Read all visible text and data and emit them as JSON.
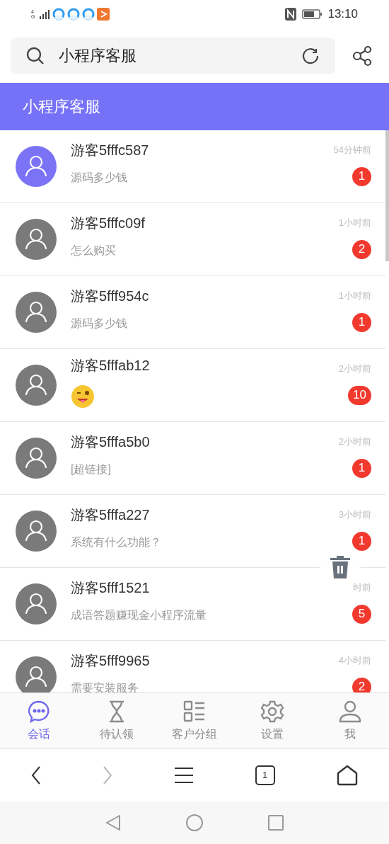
{
  "status_bar": {
    "network": "4G",
    "time": "13:10"
  },
  "search": {
    "value": "小程序客服"
  },
  "header": {
    "title": "小程序客服"
  },
  "conversations": [
    {
      "name": "游客5fffc587",
      "message": "源码多少钱",
      "kind": "text",
      "time": "54分钟前",
      "unread": "1",
      "color": "#7b73f5"
    },
    {
      "name": "游客5fffc09f",
      "message": "怎么购买",
      "kind": "text",
      "time": "1小时前",
      "unread": "2",
      "color": "#7a7a7a"
    },
    {
      "name": "游客5fff954c",
      "message": "源码多少钱",
      "kind": "text",
      "time": "1小时前",
      "unread": "1",
      "color": "#7a7a7a"
    },
    {
      "name": "游客5fffab12",
      "kind": "emoji",
      "time": "2小时前",
      "unread": "10",
      "color": "#7a7a7a"
    },
    {
      "name": "游客5fffa5b0",
      "message": "[超链接]",
      "kind": "text",
      "time": "2小时前",
      "unread": "1",
      "color": "#7a7a7a"
    },
    {
      "name": "游客5fffa227",
      "message": "系统有什么功能？",
      "kind": "text",
      "time": "3小时前",
      "unread": "1",
      "color": "#7a7a7a"
    },
    {
      "name": "游客5fff1521",
      "message": "成语答题赚现金小程序流量",
      "kind": "text",
      "time": "时前",
      "unread": "5",
      "color": "#7a7a7a"
    },
    {
      "name": "游客5fff9965",
      "message": "需要安装服务",
      "kind": "text",
      "time": "4小时前",
      "unread": "2",
      "color": "#7a7a7a"
    }
  ],
  "tabs": [
    {
      "label": "会话",
      "selected": true
    },
    {
      "label": "待认领",
      "selected": false
    },
    {
      "label": "客户分组",
      "selected": false
    },
    {
      "label": "设置",
      "selected": false
    },
    {
      "label": "我",
      "selected": false
    }
  ],
  "browser_nav": {
    "tab_count": "1"
  }
}
